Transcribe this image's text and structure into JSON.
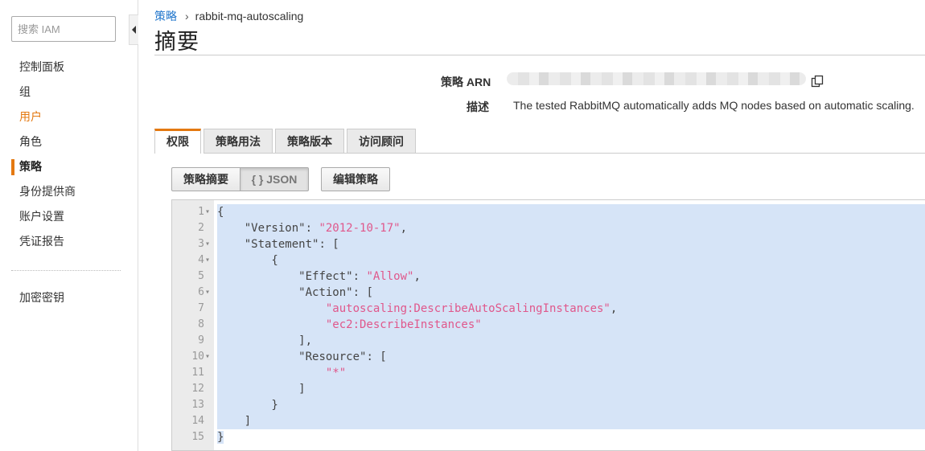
{
  "sidebar": {
    "search_placeholder": "搜索 IAM",
    "items": [
      {
        "label": "控制面板",
        "state": "normal"
      },
      {
        "label": "组",
        "state": "normal"
      },
      {
        "label": "用户",
        "state": "highlight"
      },
      {
        "label": "角色",
        "state": "normal"
      },
      {
        "label": "策略",
        "state": "active"
      },
      {
        "label": "身份提供商",
        "state": "normal"
      },
      {
        "label": "账户设置",
        "state": "normal"
      },
      {
        "label": "凭证报告",
        "state": "normal"
      }
    ],
    "extra_item": "加密密钥"
  },
  "breadcrumb": {
    "parent": "策略",
    "current": "rabbit-mq-autoscaling"
  },
  "page_title": "摘要",
  "summary": {
    "arn_label": "策略 ARN",
    "description_label": "描述",
    "description": "The tested RabbitMQ automatically adds MQ nodes based on automatic scaling."
  },
  "tabs": [
    "权限",
    "策略用法",
    "策略版本",
    "访问顾问"
  ],
  "buttons": {
    "policy_summary": "策略摘要",
    "json": "{ } JSON",
    "edit_policy": "编辑策略"
  },
  "editor": {
    "lines": [
      {
        "no": "1",
        "fold": true
      },
      {
        "no": "2",
        "fold": false
      },
      {
        "no": "3",
        "fold": true
      },
      {
        "no": "4",
        "fold": true
      },
      {
        "no": "5",
        "fold": false
      },
      {
        "no": "6",
        "fold": true
      },
      {
        "no": "7",
        "fold": false
      },
      {
        "no": "8",
        "fold": false
      },
      {
        "no": "9",
        "fold": false
      },
      {
        "no": "10",
        "fold": true
      },
      {
        "no": "11",
        "fold": false
      },
      {
        "no": "12",
        "fold": false
      },
      {
        "no": "13",
        "fold": false
      },
      {
        "no": "14",
        "fold": false
      },
      {
        "no": "15",
        "fold": false
      }
    ],
    "code": {
      "version_key": "\"Version\"",
      "version_value": "\"2012-10-17\"",
      "statement_key": "\"Statement\"",
      "effect_key": "\"Effect\"",
      "effect_value": "\"Allow\"",
      "action_key": "\"Action\"",
      "action_1": "\"autoscaling:DescribeAutoScalingInstances\"",
      "action_2": "\"ec2:DescribeInstances\"",
      "resource_key": "\"Resource\"",
      "resource_1": "\"*\""
    }
  },
  "colors": {
    "accent": "#e47911",
    "link": "#2277cc",
    "selection": "#d6e4f7",
    "json_string": "#e0578b"
  }
}
